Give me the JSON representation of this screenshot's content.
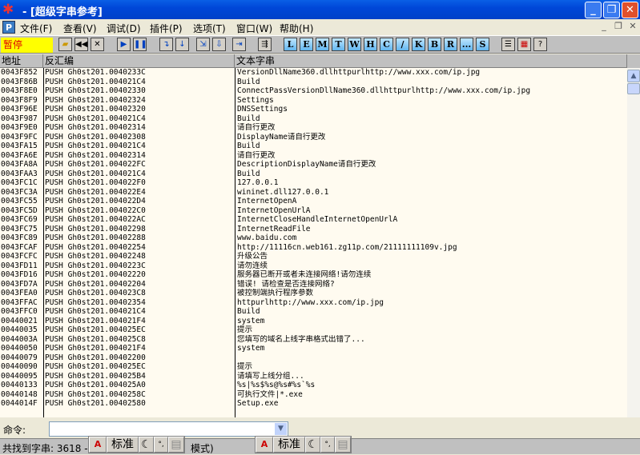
{
  "window": {
    "title": "- [超级字串参考]"
  },
  "menu": [
    "文件(F)",
    "查看(V)",
    "调试(D)",
    "插件(P)",
    "选项(T)",
    "窗口(W)",
    "帮助(H)"
  ],
  "toolbar": {
    "status": "暂停",
    "letter_buttons": [
      "L",
      "E",
      "M",
      "T",
      "W",
      "H",
      "C",
      "/",
      "K",
      "B",
      "R",
      "...",
      "S"
    ]
  },
  "columns": [
    "地址",
    "反汇编",
    "文本字串"
  ],
  "rows": [
    [
      "0043F852",
      "PUSH Gh0st201.0040233C",
      "VersionDllName360.dllhttpurlhttp://www.xxx.com/ip.jpg"
    ],
    [
      "0043F86B",
      "PUSH Gh0st201.004021C4",
      "Build"
    ],
    [
      "0043F8E0",
      "PUSH Gh0st201.00402330",
      "ConnectPassVersionDllName360.dllhttpurlhttp://www.xxx.com/ip.jpg"
    ],
    [
      "0043F8F9",
      "PUSH Gh0st201.00402324",
      "Settings"
    ],
    [
      "0043F96E",
      "PUSH Gh0st201.00402320",
      "DNSSettings"
    ],
    [
      "0043F987",
      "PUSH Gh0st201.004021C4",
      "Build"
    ],
    [
      "0043F9E0",
      "PUSH Gh0st201.00402314",
      "请自行更改"
    ],
    [
      "0043F9FC",
      "PUSH Gh0st201.00402308",
      "DisplayName请自行更改"
    ],
    [
      "0043FA15",
      "PUSH Gh0st201.004021C4",
      "Build"
    ],
    [
      "0043FA6E",
      "PUSH Gh0st201.00402314",
      "请自行更改"
    ],
    [
      "0043FA8A",
      "PUSH Gh0st201.004022FC",
      "DescriptionDisplayName请自行更改"
    ],
    [
      "0043FAA3",
      "PUSH Gh0st201.004021C4",
      "Build"
    ],
    [
      "0043FC1C",
      "PUSH Gh0st201.004022F0",
      "127.0.0.1"
    ],
    [
      "0043FC3A",
      "PUSH Gh0st201.004022E4",
      "wininet.dll127.0.0.1"
    ],
    [
      "0043FC55",
      "PUSH Gh0st201.004022D4",
      "InternetOpenA"
    ],
    [
      "0043FC5D",
      "PUSH Gh0st201.004022C0",
      "InternetOpenUrlA"
    ],
    [
      "0043FC69",
      "PUSH Gh0st201.004022AC",
      "InternetCloseHandleInternetOpenUrlA"
    ],
    [
      "0043FC75",
      "PUSH Gh0st201.00402298",
      "InternetReadFile"
    ],
    [
      "0043FC89",
      "PUSH Gh0st201.00402288",
      "www.baidu.com"
    ],
    [
      "0043FCAF",
      "PUSH Gh0st201.00402254",
      "http://11116cn.web161.zg11p.com/21111111109v.jpg"
    ],
    [
      "0043FCFC",
      "PUSH Gh0st201.00402248",
      "升级公告"
    ],
    [
      "0043FD11",
      "PUSH Gh0st201.0040223C",
      "请勿连续"
    ],
    [
      "0043FD16",
      "PUSH Gh0st201.00402220",
      "服务器已断开或者未连接网络!请勿连续"
    ],
    [
      "0043FD7A",
      "PUSH Gh0st201.00402204",
      "错误! 请检查是否连接网络?"
    ],
    [
      "0043FEA0",
      "PUSH Gh0st201.004023C8",
      "被控制端执行程序参数"
    ],
    [
      "0043FFAC",
      "PUSH Gh0st201.00402354",
      "httpurlhttp://www.xxx.com/ip.jpg"
    ],
    [
      "0043FFC0",
      "PUSH Gh0st201.004021C4",
      "Build"
    ],
    [
      "00440021",
      "PUSH Gh0st201.004021F4",
      "system"
    ],
    [
      "00440035",
      "PUSH Gh0st201.004025EC",
      "提示"
    ],
    [
      "0044003A",
      "PUSH Gh0st201.004025C8",
      "您填写的域名上线字串格式出错了..."
    ],
    [
      "00440050",
      "PUSH Gh0st201.004021F4",
      "system"
    ],
    [
      "00440079",
      "PUSH Gh0st201.00402200",
      ""
    ],
    [
      "00440090",
      "PUSH Gh0st201.004025EC",
      "提示"
    ],
    [
      "00440095",
      "PUSH Gh0st201.004025B4",
      "请填写上线分组..."
    ],
    [
      "00440133",
      "PUSH Gh0st201.004025A0",
      "%s|%s$%s@%s#%s`%s"
    ],
    [
      "00440148",
      "PUSH Gh0st201.0040258C",
      "可执行文件|*.exe"
    ],
    [
      "0044014F",
      "PUSH Gh0st201.00402580",
      "Setup.exe"
    ]
  ],
  "command": {
    "label": "命令:",
    "value": ""
  },
  "statusbar": {
    "text": "共找到字串: 3618 -",
    "text2": "模式)"
  },
  "ime": {
    "mode": "标准"
  }
}
